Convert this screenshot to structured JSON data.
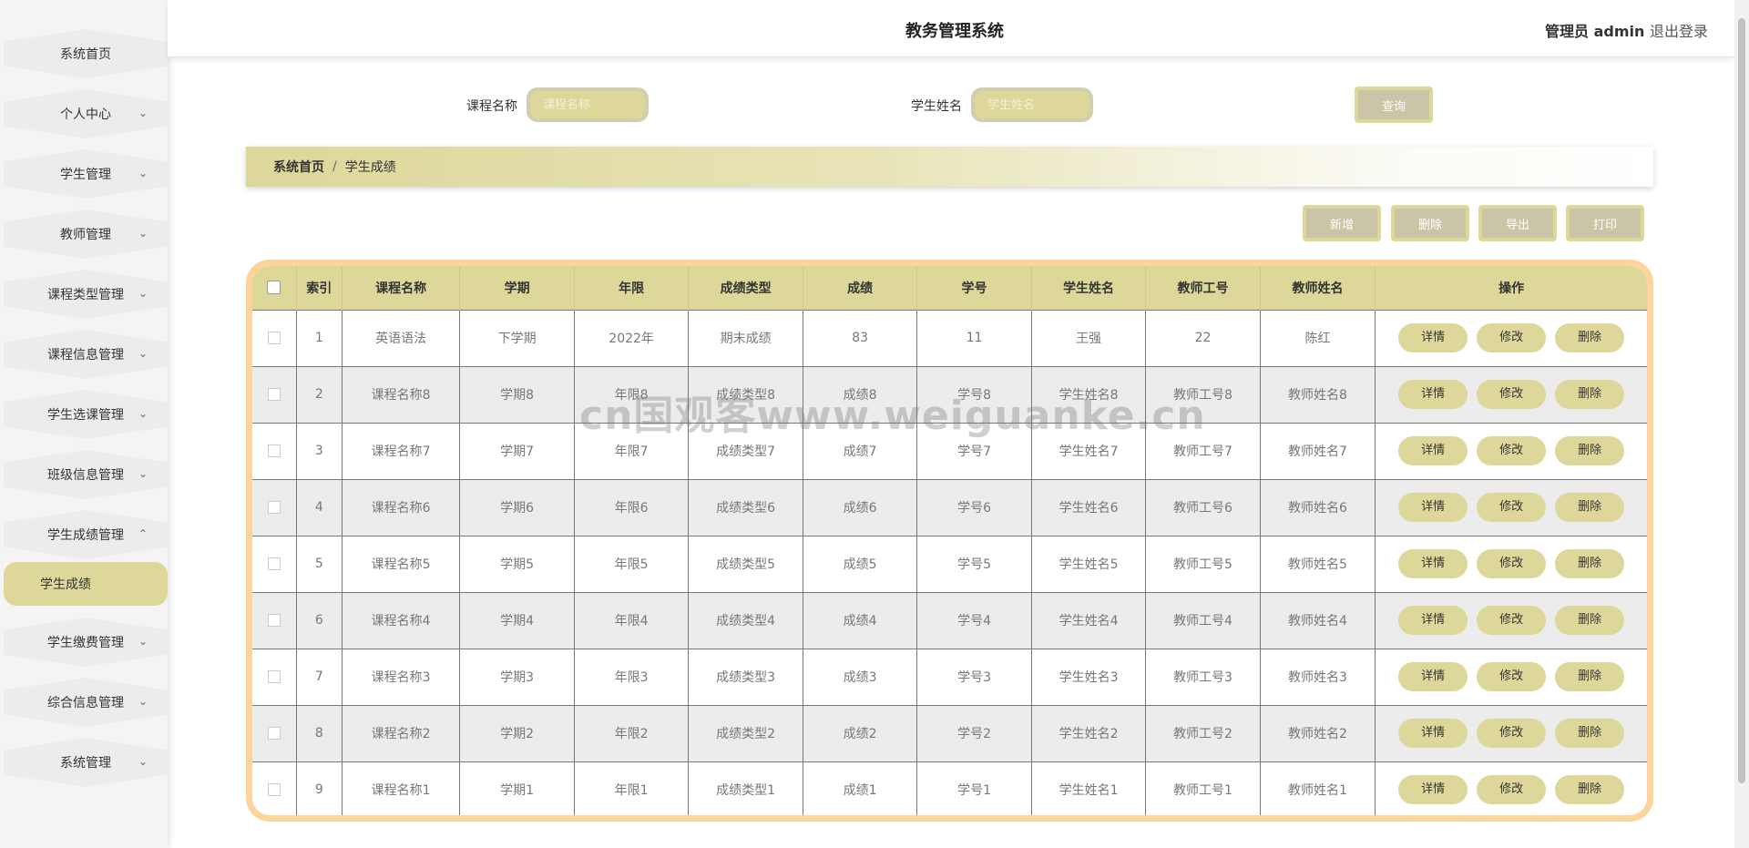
{
  "header": {
    "title": "教务管理系统",
    "admin": "管理员 admin",
    "logout": "退出登录"
  },
  "sidebar": {
    "items": [
      {
        "label": "系统首页"
      },
      {
        "label": "个人中心"
      },
      {
        "label": "学生管理"
      },
      {
        "label": "教师管理"
      },
      {
        "label": "课程类型管理"
      },
      {
        "label": "课程信息管理"
      },
      {
        "label": "学生选课管理"
      },
      {
        "label": "班级信息管理"
      },
      {
        "label": "学生成绩管理"
      },
      {
        "label": "学生缴费管理"
      },
      {
        "label": "综合信息管理"
      },
      {
        "label": "系统管理"
      }
    ],
    "active_sub": "学生成绩",
    "chevron_down": "⌄",
    "chevron_up": "⌃"
  },
  "search": {
    "course_label": "课程名称",
    "course_placeholder": "课程名称",
    "student_label": "学生姓名",
    "student_placeholder": "学生姓名",
    "query_button": "查询"
  },
  "breadcrumb": {
    "home": "系统首页",
    "sep": "/",
    "current": "学生成绩"
  },
  "actions": {
    "add": "新增",
    "delete": "删除",
    "export": "导出",
    "print": "打印"
  },
  "table": {
    "columns": [
      "索引",
      "课程名称",
      "学期",
      "年限",
      "成绩类型",
      "成绩",
      "学号",
      "学生姓名",
      "教师工号",
      "教师姓名",
      "操作"
    ],
    "rows": [
      [
        "1",
        "英语语法",
        "下学期",
        "2022年",
        "期末成绩",
        "83",
        "11",
        "王强",
        "22",
        "陈红"
      ],
      [
        "2",
        "课程名称8",
        "学期8",
        "年限8",
        "成绩类型8",
        "成绩8",
        "学号8",
        "学生姓名8",
        "教师工号8",
        "教师姓名8"
      ],
      [
        "3",
        "课程名称7",
        "学期7",
        "年限7",
        "成绩类型7",
        "成绩7",
        "学号7",
        "学生姓名7",
        "教师工号7",
        "教师姓名7"
      ],
      [
        "4",
        "课程名称6",
        "学期6",
        "年限6",
        "成绩类型6",
        "成绩6",
        "学号6",
        "学生姓名6",
        "教师工号6",
        "教师姓名6"
      ],
      [
        "5",
        "课程名称5",
        "学期5",
        "年限5",
        "成绩类型5",
        "成绩5",
        "学号5",
        "学生姓名5",
        "教师工号5",
        "教师姓名5"
      ],
      [
        "6",
        "课程名称4",
        "学期4",
        "年限4",
        "成绩类型4",
        "成绩4",
        "学号4",
        "学生姓名4",
        "教师工号4",
        "教师姓名4"
      ],
      [
        "7",
        "课程名称3",
        "学期3",
        "年限3",
        "成绩类型3",
        "成绩3",
        "学号3",
        "学生姓名3",
        "教师工号3",
        "教师姓名3"
      ],
      [
        "8",
        "课程名称2",
        "学期2",
        "年限2",
        "成绩类型2",
        "成绩2",
        "学号2",
        "学生姓名2",
        "教师工号2",
        "教师姓名2"
      ],
      [
        "9",
        "课程名称1",
        "学期1",
        "年限1",
        "成绩类型1",
        "成绩1",
        "学号1",
        "学生姓名1",
        "教师工号1",
        "教师姓名1"
      ]
    ],
    "row_actions": {
      "detail": "详情",
      "edit": "修改",
      "delete": "删除"
    }
  },
  "watermark": "cn国观客www.weiguanke.cn",
  "colors": {
    "accent": "#ddd79a",
    "border_accent": "#fdd49b",
    "button_gray": "#c9c5a6"
  }
}
